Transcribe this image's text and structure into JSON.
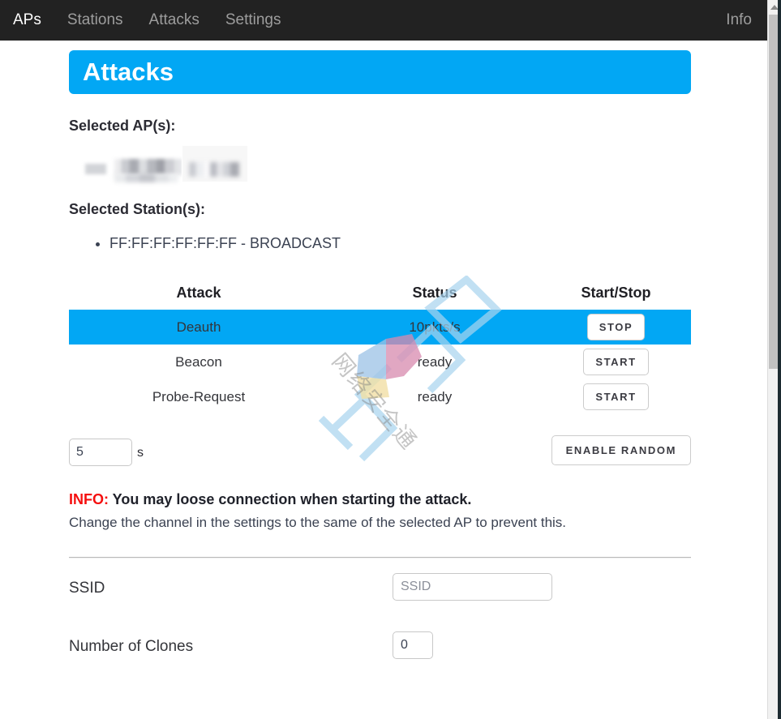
{
  "navbar": {
    "items": [
      {
        "label": "APs",
        "name": "nav-aps"
      },
      {
        "label": "Stations",
        "name": "nav-stations"
      },
      {
        "label": "Attacks",
        "name": "nav-attacks"
      },
      {
        "label": "Settings",
        "name": "nav-settings"
      }
    ],
    "right_label": "Info"
  },
  "page": {
    "title": "Attacks",
    "accent_color": "#02a7f4",
    "header_bg": "#222222"
  },
  "selected_aps": {
    "heading": "Selected AP(s):",
    "items": [
      {
        "label": "",
        "redacted": true
      }
    ]
  },
  "selected_stations": {
    "heading": "Selected Station(s):",
    "items": [
      "FF:FF:FF:FF:FF:FF - BROADCAST"
    ]
  },
  "attack_table": {
    "headers": [
      "Attack",
      "Status",
      "Start/Stop"
    ],
    "rows": [
      {
        "attack": "Deauth",
        "status": "10pkts/s",
        "status_state": "running",
        "button": "STOP",
        "active": true
      },
      {
        "attack": "Beacon",
        "status": "ready",
        "status_state": "ready",
        "button": "START",
        "active": false
      },
      {
        "attack": "Probe-Request",
        "status": "ready",
        "status_state": "ready",
        "button": "START",
        "active": false
      }
    ],
    "status_colors": {
      "running": "#f01e1e",
      "ready": "#22b422"
    }
  },
  "timer": {
    "value": "5",
    "unit": "s",
    "random_button": "ENABLE RANDOM"
  },
  "info": {
    "tag": "INFO:",
    "line1": " You may loose connection when starting the attack.",
    "line2": "Change the channel in the settings to the same of the selected AP to prevent this."
  },
  "form": {
    "ssid": {
      "label": "SSID",
      "value": "",
      "placeholder": "SSID"
    },
    "clones": {
      "label": "Number of Clones",
      "value": "0",
      "placeholder": ""
    }
  },
  "watermark": {
    "text": "网络安全通"
  }
}
